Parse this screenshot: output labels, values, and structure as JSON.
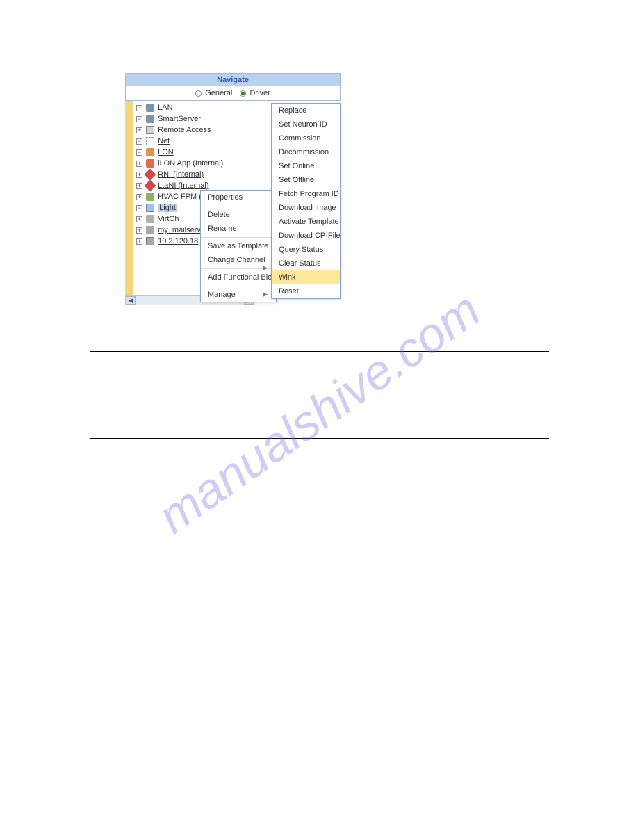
{
  "header": {
    "title": "Navigate"
  },
  "mode": {
    "general_label": "General",
    "driver_label": "Driver",
    "selected": "driver"
  },
  "tree": {
    "root": "LAN",
    "smartserver": "SmartServer",
    "remote_access": "Remote Access",
    "net": "Net",
    "lon": "LON",
    "ilon_app": "iLON App (Internal)",
    "rni": "RNI (Internal)",
    "ltani": "LtaNI (Internal)",
    "hvac": "HVAC FPM (Internal)",
    "light": "Light",
    "virtch": "VirtCh",
    "mailserver": "my_mailserv",
    "host": "10.2.120.18"
  },
  "context_menu": {
    "properties": "Properties",
    "delete": "Delete",
    "rename": "Rename",
    "save_as_template": "Save as Template",
    "change_channel": "Change Channel",
    "add_functional_block": "Add Functional Block",
    "manage": "Manage"
  },
  "manage_submenu": {
    "replace": "Replace",
    "set_neuron_id": "Set Neuron ID",
    "commission": "Commission",
    "decommission": "Decommission",
    "set_online": "Set Online",
    "set_offline": "Set Offline",
    "fetch_program_id": "Fetch Program ID",
    "download_image": "Download Image",
    "activate_template": "Activate Template",
    "download_cp_file": "Download CP-File",
    "query_status": "Query Status",
    "clear_status": "Clear Status",
    "wink": "Wink",
    "reset": "Reset"
  },
  "watermark": "manualshive.com"
}
